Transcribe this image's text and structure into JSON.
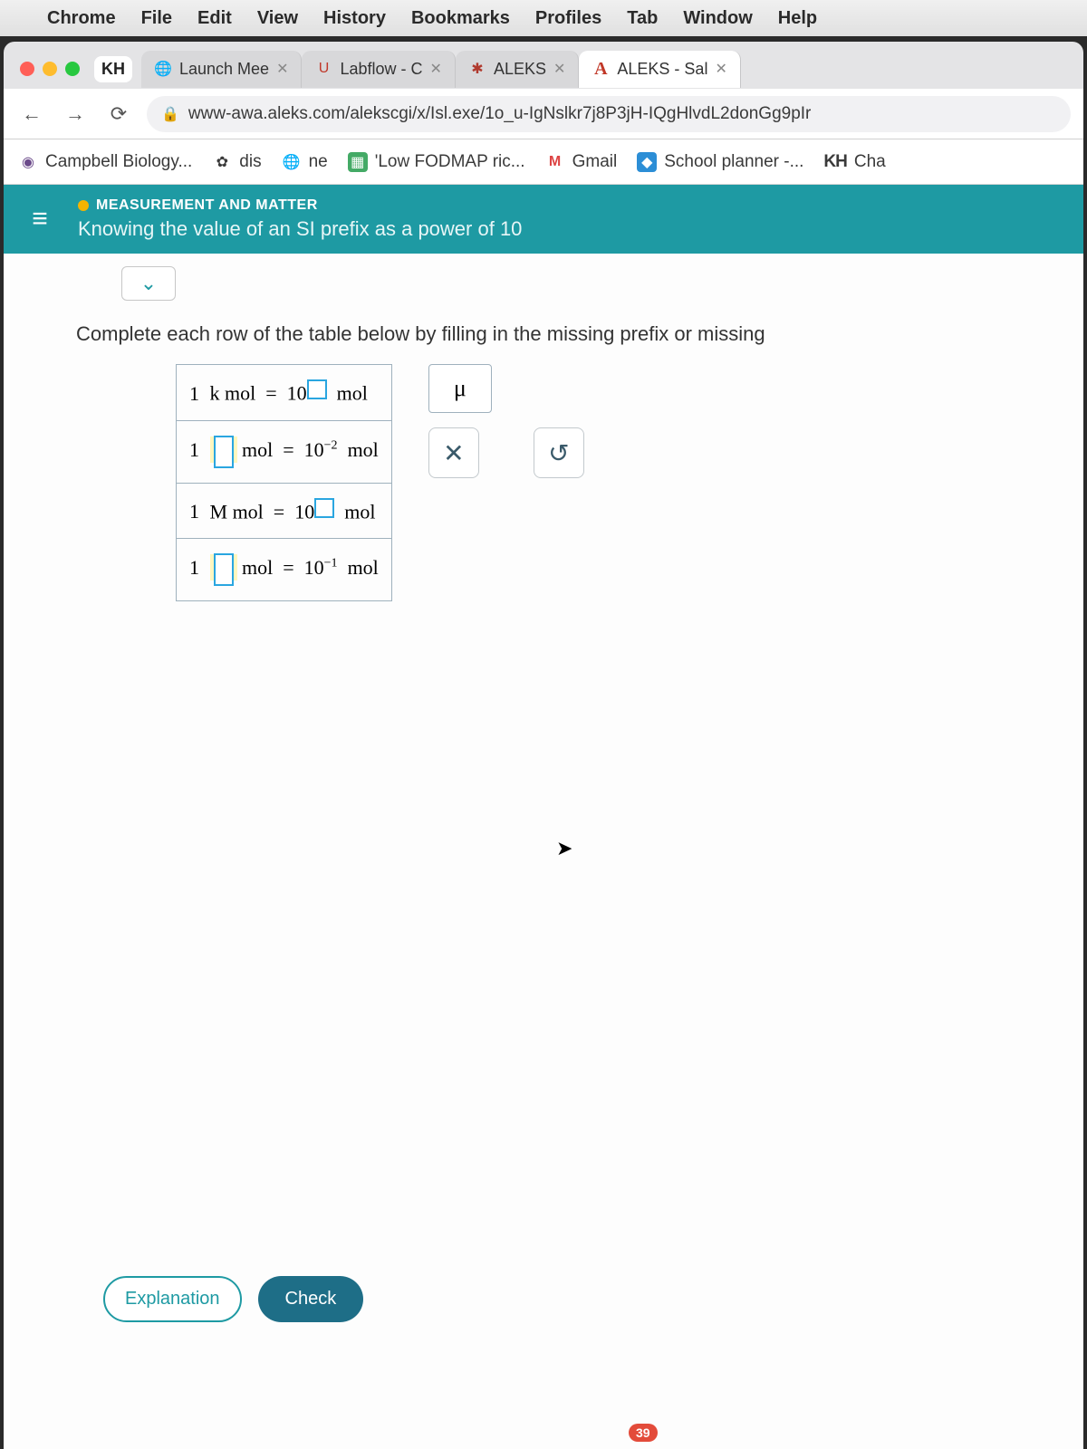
{
  "menubar": {
    "app": "Chrome",
    "items": [
      "File",
      "Edit",
      "View",
      "History",
      "Bookmarks",
      "Profiles",
      "Tab",
      "Window",
      "Help"
    ]
  },
  "chrome": {
    "profile": "KH",
    "tabs": [
      {
        "label": "Launch Mee"
      },
      {
        "label": "Labflow - C"
      },
      {
        "label": "ALEKS"
      },
      {
        "label": "ALEKS - Sal",
        "active": true
      }
    ],
    "url": "www-awa.aleks.com/alekscgi/x/Isl.exe/1o_u-IgNslkr7j8P3jH-IQgHlvdL2donGg9pIr"
  },
  "bookmarks": [
    {
      "label": "Campbell Biology..."
    },
    {
      "label": "dis"
    },
    {
      "label": "ne"
    },
    {
      "label": "'Low FODMAP ric..."
    },
    {
      "label": "Gmail"
    },
    {
      "label": "School planner -..."
    },
    {
      "label": "Cha",
      "prefix": "KH"
    }
  ],
  "aleks": {
    "breadcrumb": "MEASUREMENT AND MATTER",
    "title": "Knowing the value of an SI prefix as a power of 10",
    "prompt": "Complete each row of the table below by filling in the missing prefix or missing ",
    "rows": [
      {
        "left_coef": "1",
        "left_prefix": "k",
        "left_unit": "mol",
        "exp": "",
        "exp_box": true,
        "right_unit": "mol"
      },
      {
        "left_coef": "1",
        "left_prefix_box": true,
        "left_unit": "mol",
        "highlight": true,
        "exp": "−2",
        "right_unit": "mol"
      },
      {
        "left_coef": "1",
        "left_prefix": "M",
        "left_unit": "mol",
        "exp": "",
        "exp_box": true,
        "right_unit": "mol"
      },
      {
        "left_coef": "1",
        "left_prefix_box": true,
        "left_unit": "mol",
        "highlight": true,
        "exp": "−1",
        "right_unit": "mol"
      }
    ],
    "palette": {
      "mu": "μ"
    },
    "buttons": {
      "explanation": "Explanation",
      "check": "Check"
    }
  },
  "notif_count": "39"
}
